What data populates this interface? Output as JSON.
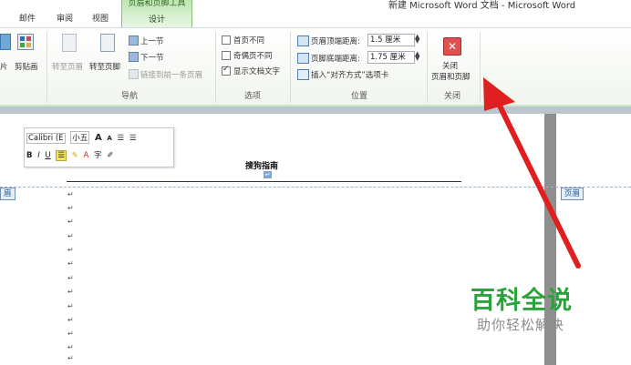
{
  "window": {
    "title": "新建 Microsoft Word 文档 - Microsoft Word"
  },
  "tabs": {
    "mail": "邮件",
    "review": "审阅",
    "view": "视图",
    "context_title": "页眉和页脚工具",
    "design": "设计"
  },
  "ribbon": {
    "left_partial": {
      "picture": "片",
      "clipart": "剪贴画"
    },
    "nav": {
      "goto_header": "转至页眉",
      "goto_footer": "转至页脚",
      "prev_section": "上一节",
      "next_section": "下一节",
      "link_prev": "链接到前一条页眉",
      "label": "导航"
    },
    "options": {
      "diff_first": "首页不同",
      "diff_odd_even": "奇偶页不同",
      "show_doc_text": "显示文档文字",
      "label": "选项"
    },
    "position": {
      "header_top_label": "页眉顶端距离:",
      "header_top_value": "1.5 厘米",
      "footer_bottom_label": "页脚底端距离:",
      "footer_bottom_value": "1.75 厘米",
      "insert_align_tab": "插入“对齐方式”选项卡",
      "label": "位置"
    },
    "close": {
      "line1": "关闭",
      "line2": "页眉和页脚",
      "label": "关闭"
    }
  },
  "mini_toolbar": {
    "font": "Calibri (E",
    "size": "小五",
    "grow": "A",
    "shrink": "A"
  },
  "document": {
    "header_text": "搜狗指南",
    "header_tag_left": "眉",
    "header_tag_right": "页眉",
    "para_marks": [
      "↵",
      "↵",
      "↵",
      "↵",
      "↵",
      "↵",
      "↵",
      "↵",
      "↵",
      "↵",
      "↵",
      "↵",
      "↵"
    ]
  },
  "watermark": {
    "title": "百科全说",
    "subtitle": "助你轻松解决"
  },
  "colors": {
    "arrow": "#e02020",
    "context_tab": "#bfe6b3",
    "watermark_green": "#2aa33a"
  }
}
